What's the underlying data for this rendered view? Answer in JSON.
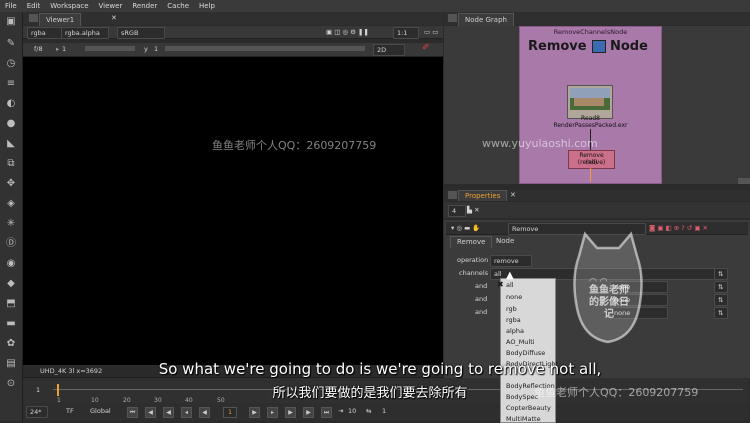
{
  "menubar": [
    "File",
    "Edit",
    "Workspace",
    "Viewer",
    "Render",
    "Cache",
    "Help"
  ],
  "viewer": {
    "tab": "Viewer1",
    "channels": "rgba",
    "alpha": "rgba.alpha",
    "colorspace": "sRGB",
    "zoom": "1:1",
    "fstop": "f/8",
    "frame_field": "1",
    "y_label": "y",
    "y_value": "1",
    "mode": "2D",
    "status": "UHD_4K 3l  x=3692"
  },
  "timeline": {
    "ticks": [
      "1",
      "10",
      "20",
      "30",
      "40",
      "50"
    ],
    "start": "1",
    "fps": "24*",
    "tf": "TF",
    "scope": "Global",
    "current": "1",
    "step": "10",
    "end": "1"
  },
  "nodegraph": {
    "tab": "Node Graph",
    "backdrop_label": "RemoveChannelsNode",
    "backdrop_title_a": "Remove",
    "backdrop_title_b": "Node",
    "read_node": "Read8",
    "read_file": "RenderPassesPacked.exr",
    "remove_node": "Remove (remove)",
    "remove_sub": "(all)"
  },
  "properties": {
    "tab": "Properties",
    "max_panels": "4",
    "node_name": "Remove",
    "tabs": [
      "Remove",
      "Node"
    ],
    "operation_label": "operation",
    "operation_value": "remove",
    "channels_label": "channels",
    "channels_value": "all",
    "and_label": "and",
    "none_value": "none",
    "menu_items": [
      "all",
      "none",
      "rgb",
      "rgba",
      "alpha",
      "AO_Multi",
      "BodyDiffuse",
      "BodyDirectLight",
      "BodyReflection",
      "BodySpec",
      "CopterBeauty",
      "MultiMatte"
    ],
    "menu_checked": "all"
  },
  "watermark": "鱼鱼老师个人QQ：2609207759",
  "watermark_url": "www.yuyulaoshi.com",
  "seal_text": "鱼鱼老师的影像日记",
  "subtitle_en": "So what we're going to do is we're going to remove not all,",
  "subtitle_zh": "所以我们要做的是我们要去除所有",
  "colors": {
    "backdrop": "#a979a9",
    "accent": "#f0a030",
    "node_remove": "#cc6f8a"
  }
}
